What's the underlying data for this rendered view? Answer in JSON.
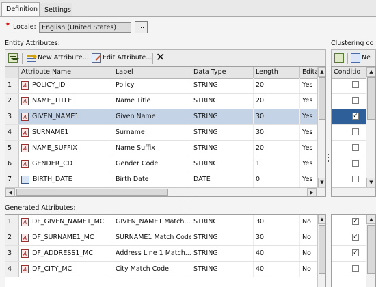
{
  "tabs": [
    {
      "label": "Definition"
    },
    {
      "label": "Settings"
    }
  ],
  "locale": {
    "label": "Locale:",
    "value": "English (United States)",
    "browse": "..."
  },
  "entity": {
    "title": "Entity Attributes:",
    "toolbar": {
      "new": "New Attribute...",
      "edit": "Edit Attribute..."
    },
    "columns": [
      "Attribute Name",
      "Label",
      "Data Type",
      "Length",
      "Edita"
    ],
    "rows": [
      {
        "n": "1",
        "name": "POLICY_ID",
        "label": "Policy",
        "type": "STRING",
        "len": "20",
        "edit": "Yes",
        "icon": "attr"
      },
      {
        "n": "2",
        "name": "NAME_TITLE",
        "label": "Name Title",
        "type": "STRING",
        "len": "20",
        "edit": "Yes",
        "icon": "attr"
      },
      {
        "n": "3",
        "name": "GIVEN_NAME1",
        "label": "Given Name",
        "type": "STRING",
        "len": "30",
        "edit": "Yes",
        "icon": "attr"
      },
      {
        "n": "4",
        "name": "SURNAME1",
        "label": "Surname",
        "type": "STRING",
        "len": "30",
        "edit": "Yes",
        "icon": "attr"
      },
      {
        "n": "5",
        "name": "NAME_SUFFIX",
        "label": "Name Suffix",
        "type": "STRING",
        "len": "20",
        "edit": "Yes",
        "icon": "attr"
      },
      {
        "n": "6",
        "name": "GENDER_CD",
        "label": "Gender Code",
        "type": "STRING",
        "len": "1",
        "edit": "Yes",
        "icon": "attr"
      },
      {
        "n": "7",
        "name": "BIRTH_DATE",
        "label": "Birth Date",
        "type": "DATE",
        "len": "0",
        "edit": "Yes",
        "icon": "date"
      }
    ],
    "selected_row": 2
  },
  "clustering": {
    "title": "Clustering co",
    "toolbar_label": "Ne",
    "column": "Conditio",
    "checks": [
      false,
      false,
      true,
      false,
      false,
      false,
      false
    ]
  },
  "generated": {
    "title": "Generated Attributes:",
    "rows": [
      {
        "n": "1",
        "name": "DF_GIVEN_NAME1_MC",
        "label": "GIVEN_NAME1 Match...",
        "type": "STRING",
        "len": "30",
        "edit": "No"
      },
      {
        "n": "2",
        "name": "DF_SURNAME1_MC",
        "label": "SURNAME1 Match Code",
        "type": "STRING",
        "len": "30",
        "edit": "No"
      },
      {
        "n": "3",
        "name": "DF_ADDRESS1_MC",
        "label": "Address Line 1 Match...",
        "type": "STRING",
        "len": "40",
        "edit": "No"
      },
      {
        "n": "4",
        "name": "DF_CITY_MC",
        "label": "City Match Code",
        "type": "STRING",
        "len": "40",
        "edit": "No"
      }
    ],
    "checks": [
      true,
      true,
      true,
      false
    ]
  },
  "splitter": "....",
  "colors": {
    "selection": "#c4d4e6",
    "selected_cell": "#2f5f99",
    "required": "#d01010"
  }
}
